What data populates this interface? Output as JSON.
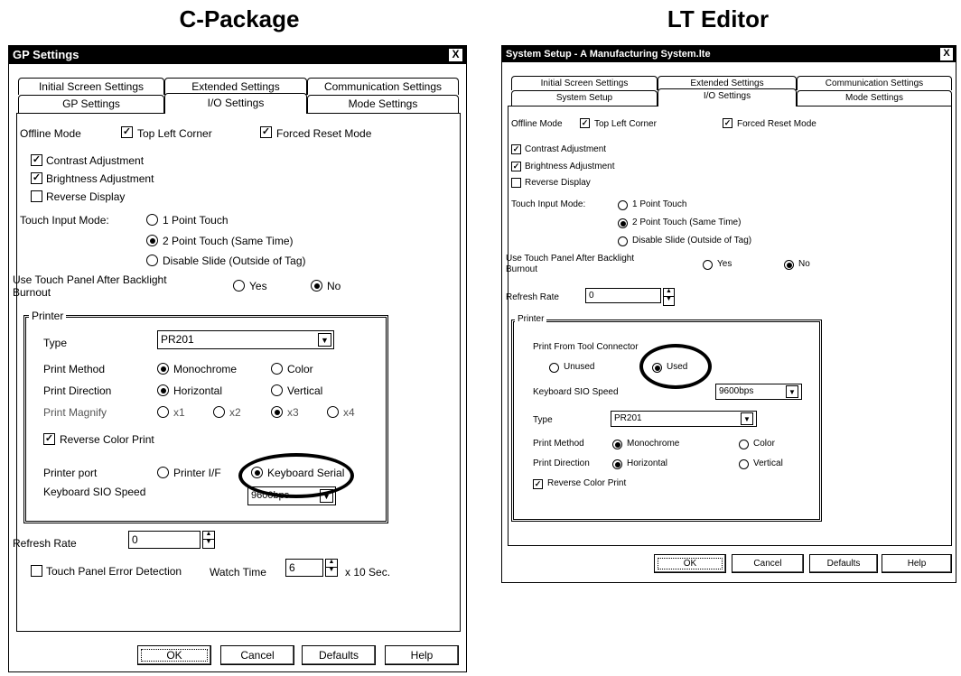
{
  "headings": {
    "left": "C-Package",
    "right": "LT Editor"
  },
  "left": {
    "title": "GP Settings",
    "close": "X",
    "tabs_back": [
      "Initial Screen Settings",
      "Extended Settings",
      "Communication Settings"
    ],
    "tabs_front": [
      "GP Settings",
      "I/O Settings",
      "Mode Settings"
    ],
    "active_tab": "I/O Settings",
    "offline_mode": "Offline Mode",
    "top_left_corner": "Top Left Corner",
    "forced_reset": "Forced Reset Mode",
    "contrast": "Contrast Adjustment",
    "brightness": "Brightness Adjustment",
    "reverse_display": "Reverse Display",
    "touch_input_mode": "Touch Input Mode:",
    "touch_opts": [
      "1 Point Touch",
      "2 Point Touch (Same Time)",
      "Disable Slide (Outside of Tag)"
    ],
    "backlight_label_1": "Use Touch Panel After Backlight",
    "backlight_label_2": "Burnout",
    "yes": "Yes",
    "no": "No",
    "printer_group": "Printer",
    "type_label": "Type",
    "type_value": "PR201",
    "print_method": "Print Method",
    "monochrome": "Monochrome",
    "color": "Color",
    "print_direction": "Print Direction",
    "horizontal": "Horizontal",
    "vertical": "Vertical",
    "print_magnify": "Print Magnify",
    "magnify_opts": [
      "x1",
      "x2",
      "x3",
      "x4"
    ],
    "reverse_color_print": "Reverse Color Print",
    "printer_port": "Printer port",
    "printer_if": "Printer I/F",
    "keyboard_serial": "Keyboard Serial",
    "kb_sio_speed": "Keyboard SIO Speed",
    "kb_sio_value": "9600bps",
    "refresh_rate": "Refresh Rate",
    "refresh_value": "0",
    "touch_error": "Touch Panel Error Detection",
    "watch_time": "Watch Time",
    "watch_value": "6",
    "watch_unit": "x 10 Sec.",
    "buttons": {
      "ok": "OK",
      "cancel": "Cancel",
      "defaults": "Defaults",
      "help": "Help"
    }
  },
  "right": {
    "title": "System Setup - A Manufacturing System.lte",
    "close": "X",
    "tabs_back": [
      "Initial Screen Settings",
      "Extended Settings",
      "Communication Settings"
    ],
    "tabs_front": [
      "System Setup",
      "I/O Settings",
      "Mode Settings"
    ],
    "active_tab": "I/O Settings",
    "offline_mode": "Offline Mode",
    "top_left_corner": "Top Left Corner",
    "forced_reset": "Forced Reset Mode",
    "contrast": "Contrast Adjustment",
    "brightness": "Brightness Adjustment",
    "reverse_display": "Reverse Display",
    "touch_input_mode": "Touch Input Mode:",
    "touch_opts": [
      "1 Point Touch",
      "2 Point Touch (Same Time)",
      "Disable Slide (Outside of Tag)"
    ],
    "backlight_label_1": "Use Touch Panel After Backlight",
    "backlight_label_2": "Burnout",
    "yes": "Yes",
    "no": "No",
    "refresh_rate": "Refresh Rate",
    "refresh_value": "0",
    "printer_group": "Printer",
    "print_from_tool": "Print From Tool Connector",
    "unused": "Unused",
    "used": "Used",
    "kb_sio_speed": "Keyboard SIO Speed",
    "kb_sio_value": "9600bps",
    "type_label": "Type",
    "type_value": "PR201",
    "print_method": "Print Method",
    "monochrome": "Monochrome",
    "color": "Color",
    "print_direction": "Print Direction",
    "horizontal": "Horizontal",
    "vertical": "Vertical",
    "reverse_color_print": "Reverse Color Print",
    "buttons": {
      "ok": "OK",
      "cancel": "Cancel",
      "defaults": "Defaults",
      "help": "Help"
    }
  }
}
